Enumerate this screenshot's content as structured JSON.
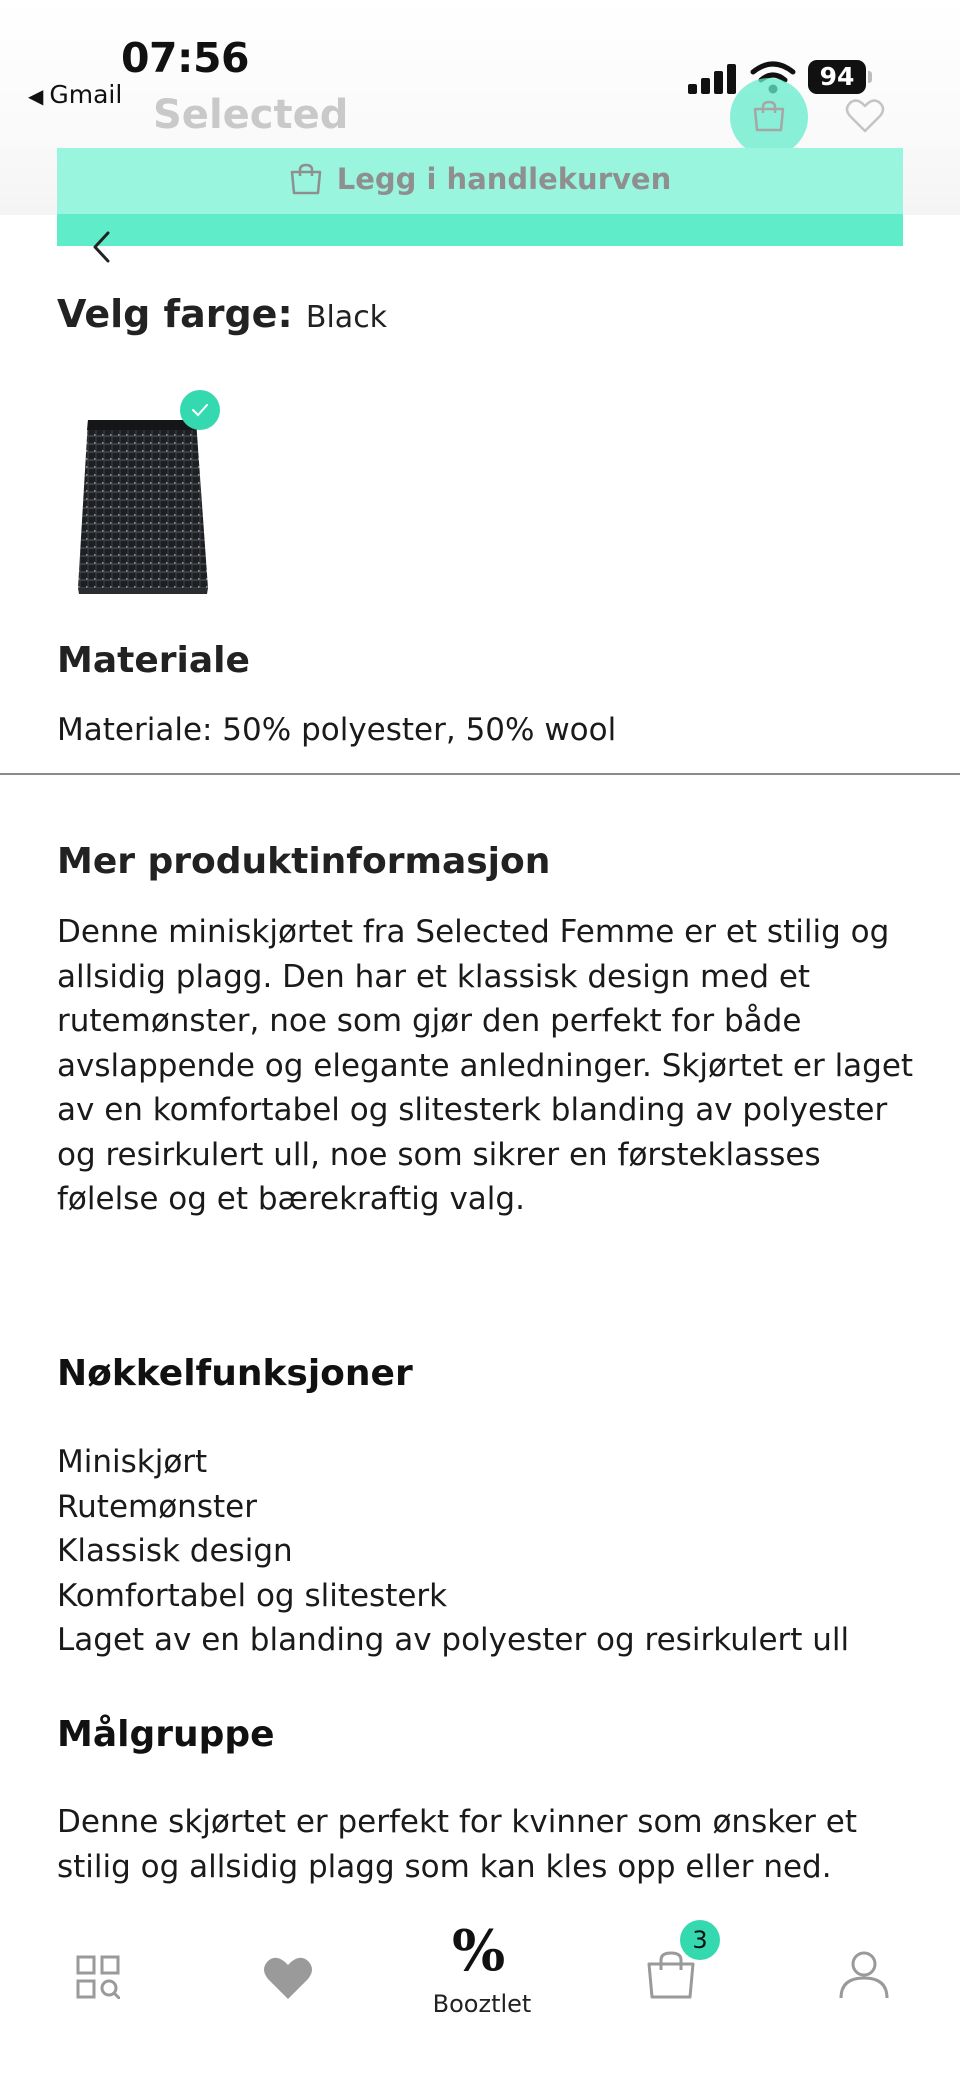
{
  "status_bar": {
    "time": "07:56",
    "back_app": "Gmail",
    "battery": "94"
  },
  "header": {
    "brand": "Selected",
    "add_to_cart_label": "Legg i handlekurven",
    "accent_color": "#5eecc9"
  },
  "color_section": {
    "heading": "Velg farge:",
    "selected_color": "Black"
  },
  "material": {
    "heading": "Materiale",
    "text": "Materiale: 50% polyester, 50% wool"
  },
  "more_info": {
    "heading": "Mer produktinformasjon",
    "lines": [
      "Denne miniskjørtet fra Selected Femme er et stilig og",
      "allsidig plagg. Den har et klassisk design med et",
      "rutemønster, noe som gjør den perfekt for både",
      "avslappende og elegante anledninger. Skjørtet er laget",
      "av en komfortabel og slitesterk blanding av polyester",
      "og resirkulert ull, noe som sikrer en førsteklasses",
      "følelse og et bærekraftig valg."
    ]
  },
  "key_features": {
    "heading": "Nøkkelfunksjoner",
    "items": [
      "Miniskjørt",
      "Rutemønster",
      "Klassisk design",
      "Komfortabel og slitesterk",
      "Laget av en blanding av polyester og resirkulert ull"
    ]
  },
  "target_group": {
    "heading": "Målgruppe",
    "lines": [
      "Denne skjørtet er perfekt for kvinner som ønsker et",
      "stilig og allsidig plagg som kan kles opp eller ned."
    ]
  },
  "tabbar": {
    "boozt_symbol": "%",
    "boozt_label": "Booztlet",
    "cart_count": "3",
    "icons": [
      "categories-search-icon",
      "heart-icon",
      "percent-icon",
      "bag-icon",
      "profile-icon"
    ]
  }
}
